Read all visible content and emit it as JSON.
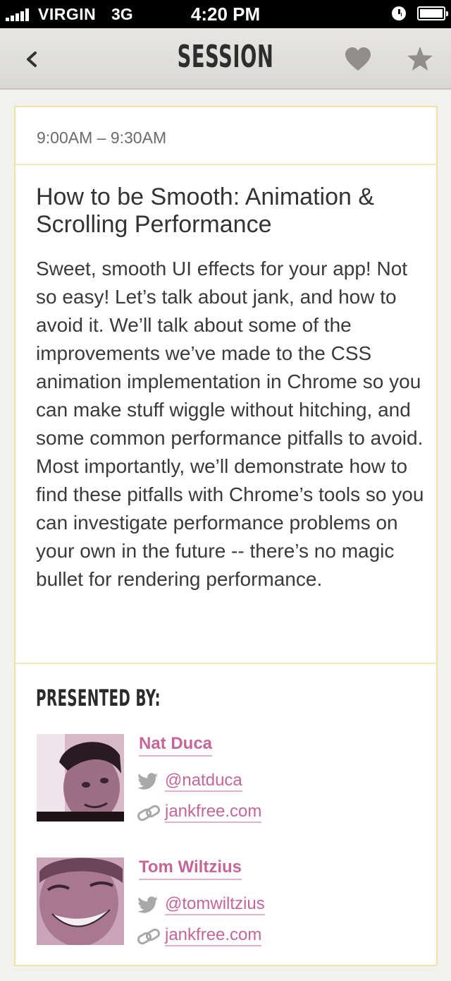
{
  "status_bar": {
    "carrier": "VIRGIN",
    "network": "3G",
    "time": "4:20 PM"
  },
  "nav": {
    "title": "SESSION",
    "back_icon": "chevron-left-icon",
    "favorite_icon": "heart-icon",
    "star_icon": "star-icon",
    "icon_color": "#8f8e8c"
  },
  "session": {
    "time": "9:00AM – 9:30AM",
    "title": "How to be Smooth: Animation & Scrolling Performance",
    "description": "Sweet, smooth UI effects for your app! Not so easy! Let’s talk about jank, and how to avoid it. We’ll talk about some of the improvements we’ve made to the CSS animation implementation in Chrome so you can make stuff wiggle without hitching, and some common performance pitfalls to avoid. Most importantly, we’ll demonstrate how to find these pitfalls with Chrome’s tools so you can investigate performance problems on your own in the future -- there’s no magic bullet for rendering performance."
  },
  "presenters": {
    "heading": "PRESENTED BY:",
    "list": [
      {
        "name": "Nat Duca",
        "twitter": "@natduca",
        "website": "jankfree.com"
      },
      {
        "name": "Tom Wiltzius",
        "twitter": "@tomwiltzius",
        "website": "jankfree.com"
      }
    ]
  },
  "colors": {
    "accent": "#c5669b",
    "card_border": "#f1e3a1",
    "background": "#f1f2ef"
  }
}
